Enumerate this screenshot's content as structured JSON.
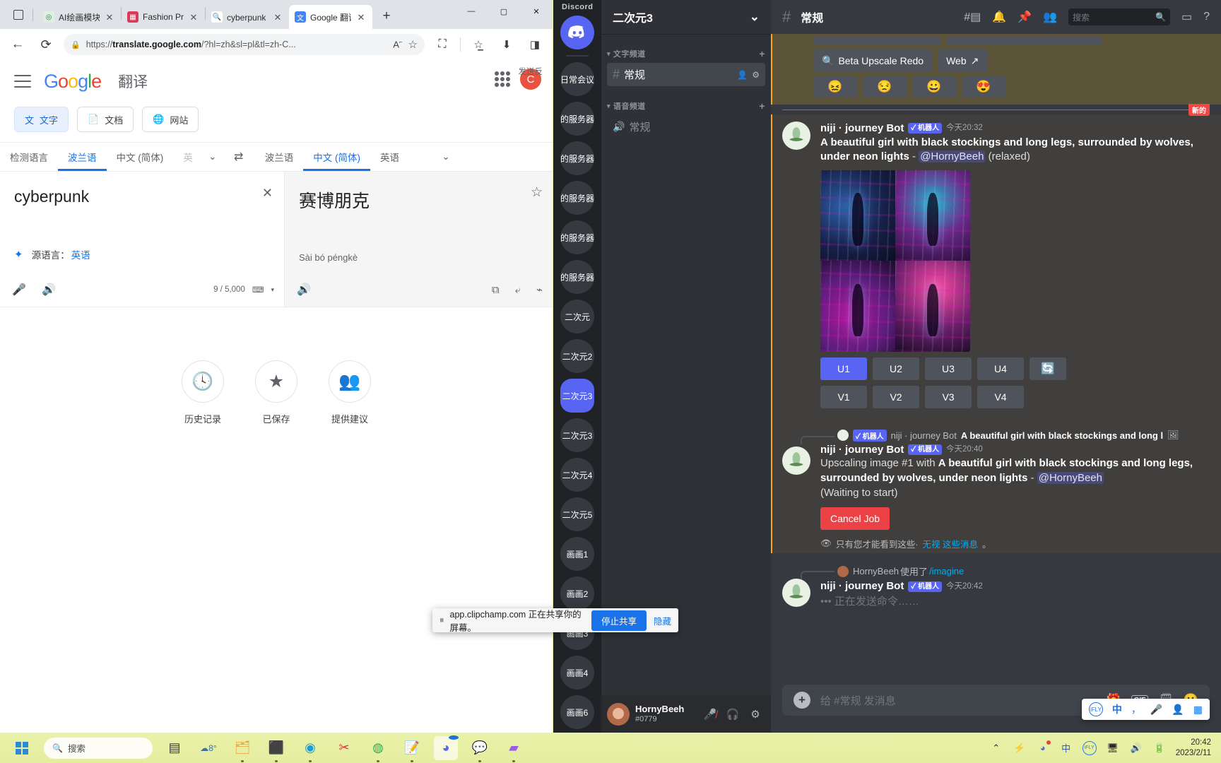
{
  "browser": {
    "tabs": [
      {
        "label": "AI绘画模块",
        "favicon_color": "#57b36a",
        "active": false
      },
      {
        "label": "Fashion Prompt",
        "favicon_color": "#d93a5a",
        "active": false
      },
      {
        "label": "cyberpunk - 搜",
        "favicon_color": "#ffffff",
        "active": false
      },
      {
        "label": "Google 翻译",
        "favicon_color": "#4285f4",
        "active": true
      }
    ],
    "new_tab_label": "+",
    "close_label": "✕",
    "window_controls": {
      "minimize": "—",
      "maximize": "▢",
      "close": "✕"
    },
    "url_prefix": "https://",
    "url_bold": "translate.google.com",
    "url_rest": "/?hl=zh&sl=pl&tl=zh-C...",
    "nav": {
      "back": "←",
      "reload": "⟳",
      "lock": "🔒",
      "read_aloud": "A",
      "favorite": "☆",
      "collections": "◳",
      "split": "⛶",
      "downloads": "⬇",
      "capture": "◨"
    }
  },
  "translate": {
    "logo": {
      "g1": "G",
      "o1": "o",
      "o2": "o",
      "g2": "g",
      "l": "l",
      "e": "e"
    },
    "title": "翻译",
    "modes": [
      {
        "label": "文字",
        "icon": "text-translate-icon",
        "active": true
      },
      {
        "label": "文档",
        "icon": "document-icon",
        "active": false
      },
      {
        "label": "网站",
        "icon": "globe-icon",
        "active": false
      }
    ],
    "source_langs": [
      {
        "label": "检测语言",
        "state": "normal"
      },
      {
        "label": "波兰语",
        "state": "selected"
      },
      {
        "label": "中文 (简体)",
        "state": "normal"
      },
      {
        "label": "英",
        "state": "faded"
      }
    ],
    "target_langs": [
      {
        "label": "波兰语",
        "state": "normal"
      },
      {
        "label": "中文 (简体)",
        "state": "selected"
      },
      {
        "label": "英语",
        "state": "normal"
      }
    ],
    "swap_icon": "⇄",
    "source_text": "cyberpunk",
    "target_text": "赛博朋克",
    "romanization": "Sài bó péngkè",
    "detected_label": "源语言：",
    "detected_lang": "英语",
    "char_count": "9 / 5,000",
    "actions": [
      {
        "label": "历史记录",
        "icon": "history-icon",
        "glyph": "🕓"
      },
      {
        "label": "已保存",
        "icon": "star-icon",
        "glyph": "★"
      },
      {
        "label": "提供建议",
        "icon": "contribute-icon",
        "glyph": "👥"
      }
    ],
    "feedback": "发送反",
    "avatar_letter": "C"
  },
  "discord": {
    "app_label": "Discord",
    "guilds": [
      {
        "label": "home",
        "type": "home"
      },
      {
        "label": "日常会议",
        "type": "normal"
      },
      {
        "label": "的服务器",
        "type": "normal"
      },
      {
        "label": "的服务器",
        "type": "normal"
      },
      {
        "label": "的服务器",
        "type": "normal"
      },
      {
        "label": "的服务器",
        "type": "normal"
      },
      {
        "label": "的服务器",
        "type": "normal"
      },
      {
        "label": "二次元",
        "type": "normal"
      },
      {
        "label": "二次元2",
        "type": "normal"
      },
      {
        "label": "二次元3",
        "type": "active"
      },
      {
        "label": "二次元3",
        "type": "normal"
      },
      {
        "label": "二次元4",
        "type": "normal"
      },
      {
        "label": "二次元5",
        "type": "normal"
      },
      {
        "label": "画画1",
        "type": "normal"
      },
      {
        "label": "画画2",
        "type": "normal"
      },
      {
        "label": "画画3",
        "type": "normal"
      },
      {
        "label": "画画4",
        "type": "normal"
      },
      {
        "label": "画画6",
        "type": "normal"
      }
    ],
    "guild_name": "二次元3",
    "guild_chevron": "⌄",
    "categories": [
      {
        "name": "文字频道",
        "add": "+",
        "channels": [
          {
            "name": "常规",
            "type": "text",
            "active": true
          }
        ]
      },
      {
        "name": "语音频道",
        "add": "+",
        "channels": [
          {
            "name": "常规",
            "type": "voice",
            "active": false
          }
        ]
      }
    ],
    "user": {
      "name": "HornyBeeh",
      "tag": "#0779",
      "mute_icon": "microphone-muted-icon",
      "deafen_icon": "headphones-icon",
      "settings_icon": "gear-icon"
    },
    "channel_header": {
      "hash": "#",
      "name": "常规",
      "icons": [
        "threads-icon",
        "bell-icon",
        "pin-icon",
        "members-icon"
      ],
      "search_placeholder": "搜索",
      "search_icon": "🔍",
      "inbox_icon": "inbox-icon",
      "help_icon": "help-icon"
    },
    "partial_message": {
      "buttons": [
        {
          "label": "Beta Upscale Redo",
          "icon": "🔍"
        },
        {
          "label": "Web",
          "icon": "↗"
        }
      ],
      "emojis": [
        "😖",
        "😒",
        "😀",
        "😍"
      ]
    },
    "new_divider": "新的",
    "messages": [
      {
        "author": "niji · journey Bot",
        "bot_badge": "✓ 机器人",
        "time": "今天20:32",
        "text_bold": "A beautiful girl with black stockings and long legs, surrounded by wolves, under neon lights",
        "text_dash": " - ",
        "mention": "@HornyBeeh",
        "text_tail": " (relaxed)",
        "image_alt": "4-panel neon cyberpunk girl with wolves grid",
        "upscale_buttons": [
          "U1",
          "U2",
          "U3",
          "U4"
        ],
        "redo_icon": "🔄",
        "variation_buttons": [
          "V1",
          "V2",
          "V3",
          "V4"
        ]
      },
      {
        "reply_author": "niji · journey Bot",
        "reply_badge": "✓ 机器人",
        "reply_text": "A beautiful girl with black stockings and long l",
        "reply_attachment_icon": "image-icon",
        "author": "niji · journey Bot",
        "bot_badge": "✓ 机器人",
        "time": "今天20:40",
        "prefix": "Upscaling image #1 with ",
        "text_bold": "A beautiful girl with black stockings and long legs, surrounded by wolves, under neon lights",
        "text_dash": " - ",
        "mention": "@HornyBeeh",
        "status": "(Waiting to start)",
        "cancel_label": "Cancel Job",
        "ephemeral_icon": "👁",
        "ephemeral_text": "只有您才能看到这些·",
        "ephemeral_link": "无视 这些消息",
        "ephemeral_tail": "。"
      },
      {
        "reply_author": "HornyBeeh",
        "reply_verb": "使用了",
        "reply_command": "/imagine",
        "author": "niji · journey Bot",
        "bot_badge": "✓ 机器人",
        "time": "今天20:42",
        "status": "正在发送命令……"
      }
    ],
    "input": {
      "placeholder": "给 #常规 发消息",
      "plus": "+",
      "gift_icon": "🎁",
      "gif_label": "GIF",
      "sticker_icon": "sticker-icon",
      "emoji_icon": "😀"
    },
    "ime": {
      "logo": "iFLY",
      "mode": "中",
      "punct": "，",
      "mic_icon": "mic-icon",
      "person_icon": "person-icon",
      "apps_icon": "apps-icon"
    }
  },
  "share_bar": {
    "pause_icon": "⏸",
    "domain": "app.clipchamp.com",
    "message": " 正在共享你的屏幕。",
    "stop_label": "停止共享",
    "hide_label": "隐藏"
  },
  "taskbar": {
    "start_label": "start-button",
    "search_placeholder": "搜索",
    "search_icon": "🔍",
    "apps": [
      {
        "name": "file-explorer-dark-icon",
        "glyph": "▰"
      },
      {
        "name": "weather-icon",
        "glyph": "8°"
      },
      {
        "name": "folder-icon",
        "glyph": "🗂"
      },
      {
        "name": "app-icon",
        "glyph": "⬛"
      },
      {
        "name": "edge-icon",
        "glyph": "◉"
      },
      {
        "name": "snipping-tool-icon",
        "glyph": "✂"
      },
      {
        "name": "chrome-icon",
        "glyph": "◍"
      },
      {
        "name": "notepad-icon",
        "glyph": "📝"
      },
      {
        "name": "discord-icon",
        "glyph": "◕"
      },
      {
        "name": "wechat-icon",
        "glyph": "💬"
      },
      {
        "name": "clipchamp-icon",
        "glyph": "▰"
      }
    ],
    "tray": [
      {
        "name": "show-hidden-icons",
        "glyph": "⌃"
      },
      {
        "name": "charging-icon",
        "glyph": "⚡"
      },
      {
        "name": "discord-tray-icon",
        "glyph": "◕"
      },
      {
        "name": "ime-tray-icon",
        "glyph": "中"
      },
      {
        "name": "iflytek-tray-icon",
        "glyph": "iFLY"
      },
      {
        "name": "display-icon",
        "glyph": "🖥"
      },
      {
        "name": "volume-icon",
        "glyph": "🔊"
      },
      {
        "name": "battery-icon",
        "glyph": "🔋"
      }
    ],
    "time": "20:42",
    "date": "2023/2/11"
  }
}
